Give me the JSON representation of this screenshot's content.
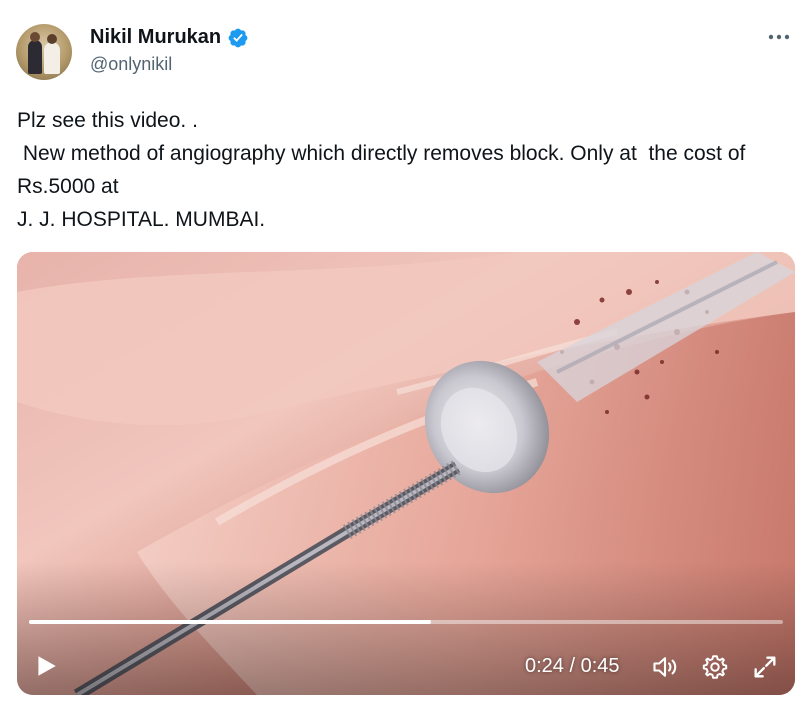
{
  "author": {
    "display_name": "Nikil Murukan",
    "handle": "@onlynikil",
    "verified": true
  },
  "tweet": {
    "text": "Plz see this video. .\n New method of angiography which directly removes block. Only at  the cost of Rs.5000 at\nJ. J. HOSPITAL. MUMBAI."
  },
  "video": {
    "time_display": "0:24 / 0:45",
    "progress_fraction": 0.533
  },
  "icons": {
    "more": "more-options-icon",
    "play": "play-icon",
    "volume": "volume-icon",
    "settings": "gear-icon",
    "fullscreen": "fullscreen-icon",
    "verified": "verified-badge-icon"
  },
  "colors": {
    "verified_blue": "#1d9bf0",
    "text_primary": "#0f1419",
    "text_secondary": "#536471"
  }
}
